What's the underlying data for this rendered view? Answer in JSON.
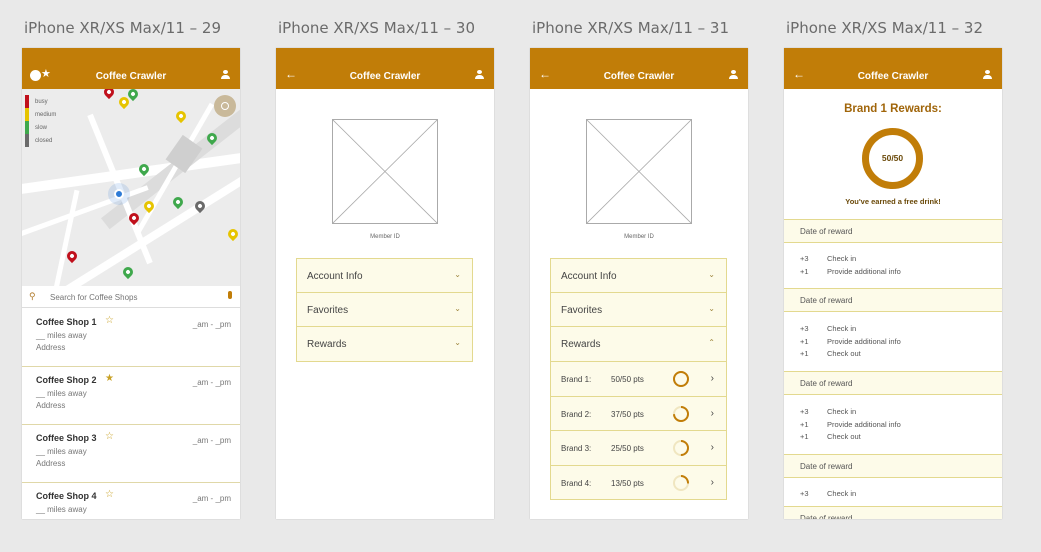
{
  "artboards": [
    {
      "label": "iPhone XR/XS Max/11 – 29"
    },
    {
      "label": "iPhone XR/XS Max/11 – 30"
    },
    {
      "label": "iPhone XR/XS Max/11 – 31"
    },
    {
      "label": "iPhone XR/XS Max/11 – 32"
    }
  ],
  "app": {
    "title": "Coffee Crawler",
    "accent": "#c17d08"
  },
  "map_screen": {
    "legend": [
      {
        "label": "busy",
        "color": "#c0101c"
      },
      {
        "label": "medium",
        "color": "#e6c400"
      },
      {
        "label": "slow",
        "color": "#3fa84c"
      },
      {
        "label": "closed",
        "color": "#6a6a6a"
      }
    ],
    "search_placeholder": "Search for Coffee Shops",
    "shops": [
      {
        "name": "Coffee Shop 1",
        "favorite": false,
        "hours": "_am - _pm",
        "distance": "__ miles away",
        "address": "Address"
      },
      {
        "name": "Coffee Shop 2",
        "favorite": true,
        "hours": "_am - _pm",
        "distance": "__ miles away",
        "address": "Address"
      },
      {
        "name": "Coffee Shop 3",
        "favorite": false,
        "hours": "_am - _pm",
        "distance": "__ miles away",
        "address": "Address"
      },
      {
        "name": "Coffee Shop 4",
        "favorite": false,
        "hours": "_am - _pm",
        "distance": "__ miles away",
        "address": "Address"
      }
    ]
  },
  "profile": {
    "member_id_label": "Member ID",
    "sections": [
      "Account Info",
      "Favorites",
      "Rewards"
    ]
  },
  "rewards_expanded": {
    "brands": [
      {
        "label": "Brand 1:",
        "points": "50/50 pts",
        "progress": 1.0
      },
      {
        "label": "Brand 2:",
        "points": "37/50 pts",
        "progress": 0.74
      },
      {
        "label": "Brand 3:",
        "points": "25/50 pts",
        "progress": 0.5
      },
      {
        "label": "Brand 4:",
        "points": "13/50 pts",
        "progress": 0.26
      }
    ]
  },
  "brand_detail": {
    "title": "Brand 1 Rewards:",
    "ring_text": "50/50",
    "earned_text": "You've earned a free drink!",
    "date_label": "Date of reward",
    "groups": [
      [
        {
          "pts": "+3",
          "desc": "Check in"
        },
        {
          "pts": "+1",
          "desc": "Provide additional info"
        }
      ],
      [
        {
          "pts": "+3",
          "desc": "Check in"
        },
        {
          "pts": "+1",
          "desc": "Provide additional info"
        },
        {
          "pts": "+1",
          "desc": "Check out"
        }
      ],
      [
        {
          "pts": "+3",
          "desc": "Check in"
        },
        {
          "pts": "+1",
          "desc": "Provide additional info"
        },
        {
          "pts": "+1",
          "desc": "Check out"
        }
      ],
      [
        {
          "pts": "+3",
          "desc": "Check in"
        }
      ],
      []
    ]
  }
}
